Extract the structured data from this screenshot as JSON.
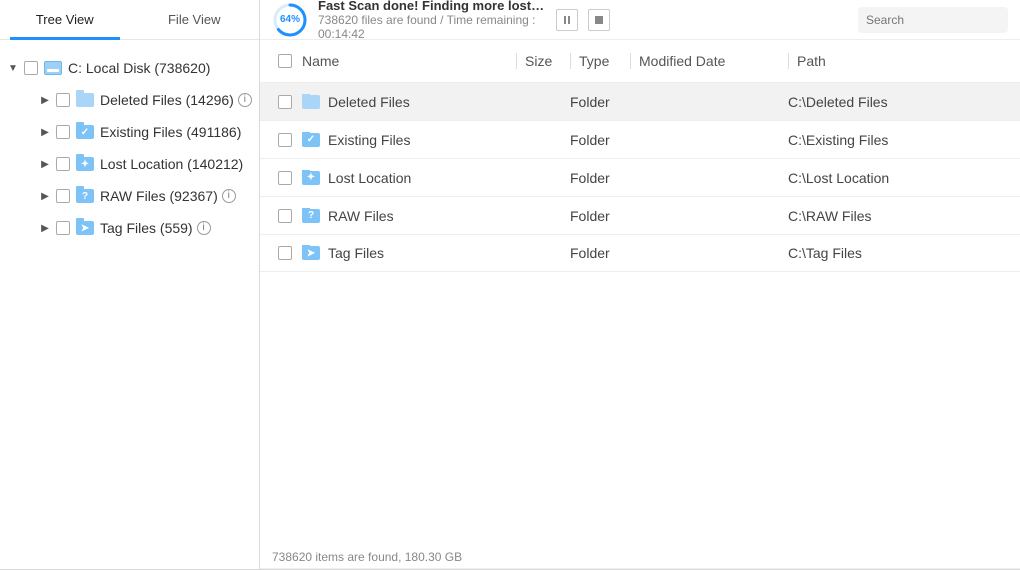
{
  "tabs": {
    "tree": "Tree View",
    "file": "File View"
  },
  "scan": {
    "percent": "64%",
    "title": "Fast Scan done! Finding more lost data with Deep Scan...",
    "found": "738620 files are found",
    "sep": " / ",
    "time": "Time remaining : 00:14:42"
  },
  "search": {
    "placeholder": "Search"
  },
  "tree": {
    "root": "C: Local Disk (738620)",
    "items": [
      {
        "label": "Deleted Files (14296)"
      },
      {
        "label": "Existing Files (491186)"
      },
      {
        "label": "Lost Location (140212)"
      },
      {
        "label": "RAW Files (92367)"
      },
      {
        "label": "Tag Files (559)"
      }
    ]
  },
  "columns": {
    "name": "Name",
    "size": "Size",
    "type": "Type",
    "mod": "Modified Date",
    "path": "Path"
  },
  "rows": [
    {
      "name": "Deleted Files",
      "type": "Folder",
      "path": "C:\\Deleted Files"
    },
    {
      "name": "Existing Files",
      "type": "Folder",
      "path": "C:\\Existing Files"
    },
    {
      "name": "Lost Location",
      "type": "Folder",
      "path": "C:\\Lost Location"
    },
    {
      "name": "RAW Files",
      "type": "Folder",
      "path": "C:\\RAW Files"
    },
    {
      "name": "Tag Files",
      "type": "Folder",
      "path": "C:\\Tag Files"
    }
  ],
  "status": "738620 items are found, 180.30 GB"
}
